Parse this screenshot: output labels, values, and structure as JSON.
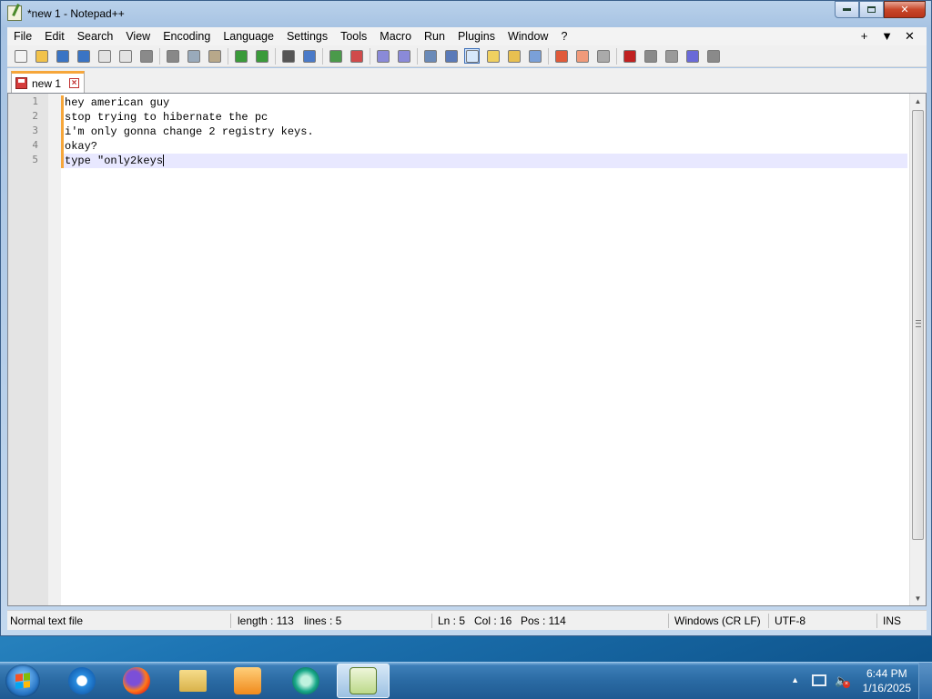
{
  "window": {
    "title": "*new 1 - Notepad++",
    "buttons": {
      "minimize": "minimize",
      "maximize": "maximize",
      "close": "✕"
    }
  },
  "menu": {
    "items": [
      "File",
      "Edit",
      "Search",
      "View",
      "Encoding",
      "Language",
      "Settings",
      "Tools",
      "Macro",
      "Run",
      "Plugins",
      "Window",
      "?"
    ],
    "right": [
      "+",
      "▼",
      "✕"
    ]
  },
  "toolbar": {
    "icons": [
      "new-file-icon",
      "open-file-icon",
      "save-icon",
      "save-all-icon",
      "close-icon",
      "close-all-icon",
      "print-icon",
      "cut-icon",
      "copy-icon",
      "paste-icon",
      "undo-icon",
      "redo-icon",
      "find-icon",
      "replace-icon",
      "zoom-in-icon",
      "zoom-out-icon",
      "sync-v-icon",
      "sync-h-icon",
      "word-wrap-icon",
      "show-all-chars-icon",
      "indent-guide-icon",
      "udl-icon",
      "doc-map-icon",
      "doc-list-icon",
      "function-list-icon",
      "folder-workspace-icon",
      "monitoring-icon",
      "record-macro-icon",
      "stop-macro-icon",
      "play-macro-icon",
      "run-macro-multiple-icon",
      "save-macro-icon"
    ]
  },
  "tabs": [
    {
      "label": "new 1",
      "modified": true
    }
  ],
  "editor": {
    "lines": [
      {
        "num": "1",
        "text": "hey american guy"
      },
      {
        "num": "2",
        "text": "stop trying to hibernate the pc"
      },
      {
        "num": "3",
        "text": "i'm only gonna change 2 registry keys."
      },
      {
        "num": "4",
        "text": "okay?"
      },
      {
        "num": "5",
        "text": "type \"only2keys"
      }
    ],
    "current_line": 5
  },
  "status": {
    "file_type": "Normal text file",
    "length": "length : 113",
    "lines": "lines : 5",
    "ln": "Ln : 5",
    "col": "Col : 16",
    "pos": "Pos : 114",
    "eol": "Windows (CR LF)",
    "encoding": "UTF-8",
    "mode": "INS"
  },
  "taskbar": {
    "apps": [
      "internet-explorer",
      "firefox",
      "file-explorer",
      "media-player",
      "chat-app",
      "notepad-plus-plus"
    ],
    "clock_time": "6:44 PM",
    "clock_date": "1/16/2025"
  },
  "colors": {
    "tab_accent": "#f6a63a",
    "current_line": "#e8e8ff",
    "close_red": "#c9472a"
  }
}
